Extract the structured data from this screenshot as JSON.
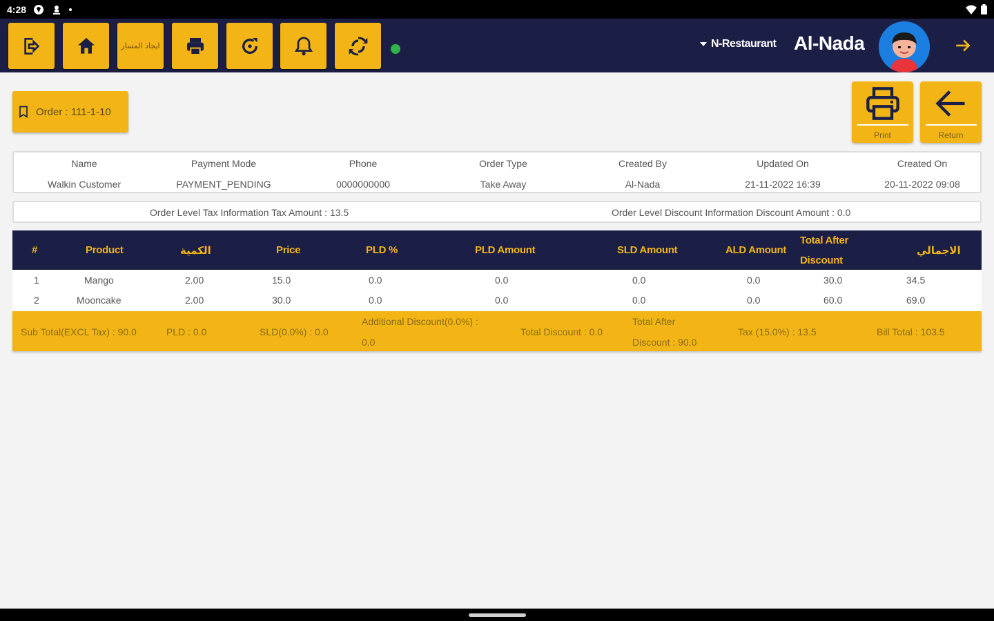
{
  "status_bar": {
    "time": "4:28"
  },
  "topbar": {
    "buttons": [
      "logout",
      "home",
      "ايجاد المسار",
      "print",
      "refresh",
      "notifications",
      "sync"
    ],
    "arabic_btn_label": "ايجاد المسار",
    "restaurant": "N-Restaurant",
    "username": "Al-Nada",
    "colors": {
      "bar": "#1c1f45",
      "accent": "#f2b515",
      "online": "#2fb34a"
    }
  },
  "order": {
    "label": "Order : 111-1-10"
  },
  "actions": {
    "print": "Print",
    "return": "Return"
  },
  "info": {
    "headers": [
      "Name",
      "Payment Mode",
      "Phone",
      "Order Type",
      "Created By",
      "Updated On",
      "Created On"
    ],
    "values": [
      "Walkin Customer",
      "PAYMENT_PENDING",
      "0000000000",
      "Take Away",
      "Al-Nada",
      "21-11-2022 16:39",
      "20-11-2022 09:08"
    ]
  },
  "tax": {
    "tax_info": "Order Level Tax Information Tax Amount : 13.5",
    "discount_info": "Order Level Discount Information Discount Amount : 0.0"
  },
  "table": {
    "headers": [
      "#",
      "Product",
      "الكمية",
      "Price",
      "PLD %",
      "PLD Amount",
      "SLD Amount",
      "ALD Amount",
      "Total After",
      "Discount",
      "الاجمالي"
    ],
    "rows": [
      [
        "1",
        "Mango",
        "2.00",
        "15.0",
        "0.0",
        "0.0",
        "0.0",
        "0.0",
        "30.0",
        "34.5"
      ],
      [
        "2",
        "Mooncake",
        "2.00",
        "30.0",
        "0.0",
        "0.0",
        "0.0",
        "0.0",
        "60.0",
        "69.0"
      ]
    ],
    "footer": {
      "subtotal": "Sub Total(EXCL Tax) : 90.0",
      "pld": "PLD : 0.0",
      "sld": "SLD(0.0%) : 0.0",
      "additional_1": "Additional Discount(0.0%) :",
      "additional_2": "0.0",
      "total_discount": "Total Discount : 0.0",
      "total_after_1": "Total After",
      "total_after_2": "Discount :  90.0",
      "tax": "Tax (15.0%) : 13.5",
      "bill_total": "Bill Total : 103.5"
    }
  }
}
